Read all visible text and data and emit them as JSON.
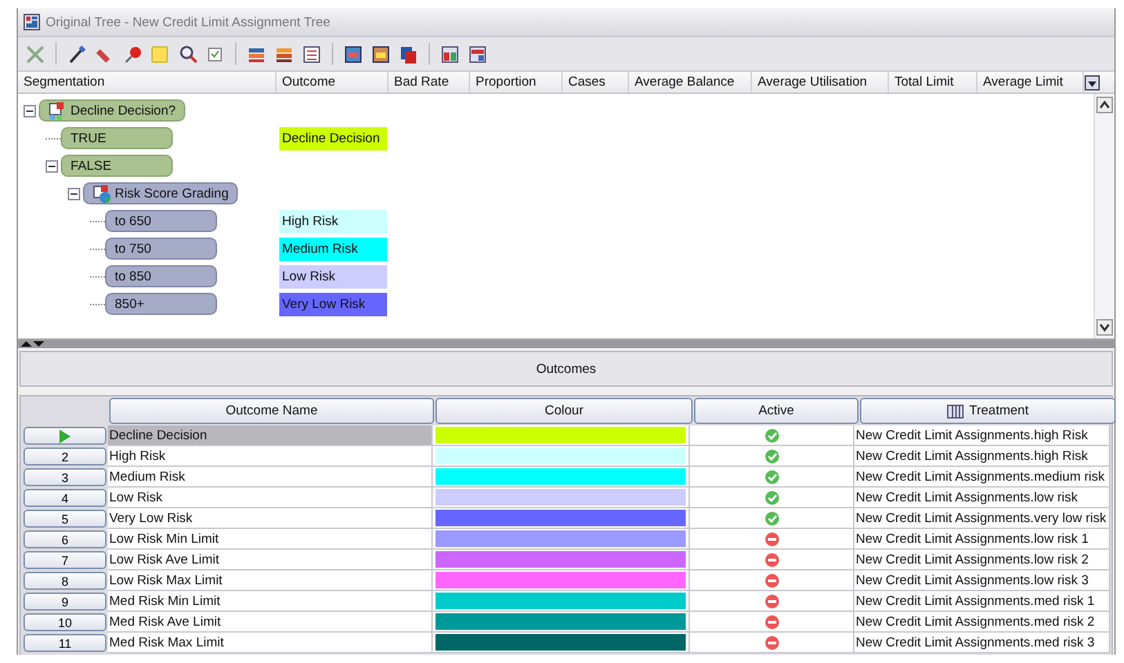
{
  "window": {
    "title": "Original Tree - New Credit Limit Assignment Tree"
  },
  "tree": {
    "columns": [
      "Segmentation",
      "Outcome",
      "Bad Rate",
      "Proportion",
      "Cases",
      "Average Balance",
      "Average Utilisation",
      "Total Limit",
      "Average Limit"
    ],
    "nodes": [
      {
        "label": "Decline Decision?",
        "kind": "decision",
        "expanded": true,
        "children": [
          {
            "label": "TRUE",
            "kind": "branch",
            "outcome": {
              "label": "Decline Decision",
              "color": "#ccff00"
            }
          },
          {
            "label": "FALSE",
            "kind": "branch",
            "expanded": true,
            "children": [
              {
                "label": "Risk Score Grading",
                "kind": "grading",
                "expanded": true,
                "children": [
                  {
                    "label": "to 650",
                    "kind": "band",
                    "outcome": {
                      "label": "High Risk",
                      "color": "#ccffff"
                    }
                  },
                  {
                    "label": "to 750",
                    "kind": "band",
                    "outcome": {
                      "label": "Medium Risk",
                      "color": "#00ffff"
                    }
                  },
                  {
                    "label": "to 850",
                    "kind": "band",
                    "outcome": {
                      "label": "Low Risk",
                      "color": "#ccccff"
                    }
                  },
                  {
                    "label": "850+",
                    "kind": "band",
                    "outcome": {
                      "label": "Very Low Risk",
                      "color": "#6666ff"
                    }
                  }
                ]
              }
            ]
          }
        ]
      }
    ]
  },
  "outcomes": {
    "title": "Outcomes",
    "columns": [
      "Outcome Name",
      "Colour",
      "Active",
      "Treatment"
    ],
    "rows": [
      {
        "selected": true,
        "name": "Decline Decision",
        "color": "#ccff00",
        "active": true,
        "treatment": "New Credit Limit Assignments.high Risk"
      },
      {
        "selected": false,
        "number": "2",
        "name": "High Risk",
        "color": "#ccffff",
        "active": true,
        "treatment": "New Credit Limit Assignments.high Risk"
      },
      {
        "selected": false,
        "number": "3",
        "name": "Medium Risk",
        "color": "#00ffff",
        "active": true,
        "treatment": "New Credit Limit Assignments.medium risk"
      },
      {
        "selected": false,
        "number": "4",
        "name": "Low Risk",
        "color": "#ccccff",
        "active": true,
        "treatment": "New Credit Limit Assignments.low risk"
      },
      {
        "selected": false,
        "number": "5",
        "name": "Very Low Risk",
        "color": "#6666ff",
        "active": true,
        "treatment": "New Credit Limit Assignments.very low risk"
      },
      {
        "selected": false,
        "number": "6",
        "name": "Low Risk Min Limit",
        "color": "#9999ff",
        "active": false,
        "treatment": "New Credit Limit Assignments.low risk 1"
      },
      {
        "selected": false,
        "number": "7",
        "name": "Low Risk Ave Limit",
        "color": "#cc66ff",
        "active": false,
        "treatment": "New Credit Limit Assignments.low risk 2"
      },
      {
        "selected": false,
        "number": "8",
        "name": "Low Risk Max Limit",
        "color": "#ff66ff",
        "active": false,
        "treatment": "New Credit Limit Assignments.low risk 3"
      },
      {
        "selected": false,
        "number": "9",
        "name": "Med Risk Min Limit",
        "color": "#00cccc",
        "active": false,
        "treatment": "New Credit Limit Assignments.med risk 1"
      },
      {
        "selected": false,
        "number": "10",
        "name": "Med Risk Ave Limit",
        "color": "#009999",
        "active": false,
        "treatment": "New Credit Limit Assignments.med risk 2"
      },
      {
        "selected": false,
        "number": "11",
        "name": "Med Risk Max Limit",
        "color": "#006666",
        "active": false,
        "treatment": "New Credit Limit Assignments.med risk 3"
      }
    ]
  }
}
